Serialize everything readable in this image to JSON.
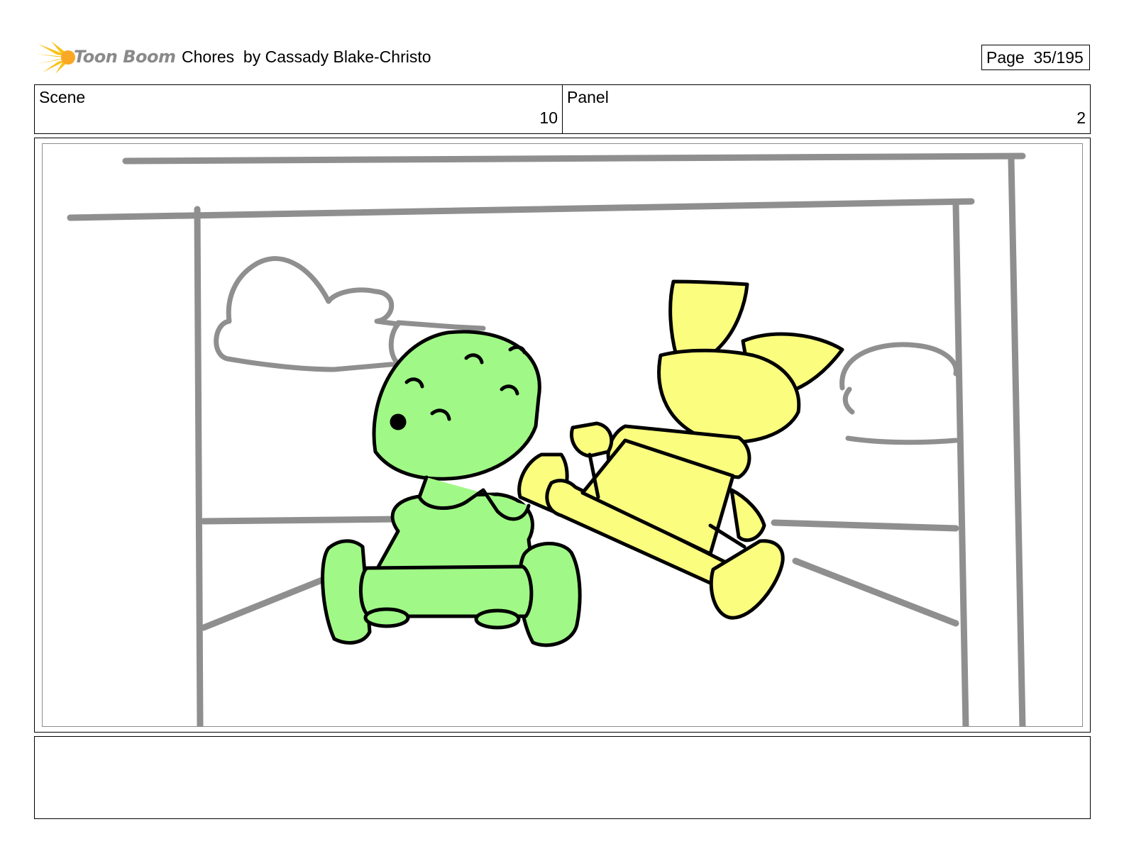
{
  "header": {
    "logo_text": "Toon Boom",
    "title": "Chores  by Cassady Blake-Christo",
    "page_label": "Page  35/195"
  },
  "info": {
    "scene_label": "Scene",
    "scene_value": "10",
    "panel_label": "Panel",
    "panel_value": "2"
  },
  "notes": {
    "text": ""
  },
  "colors": {
    "green_fill": "#a0f986",
    "yellow_fill": "#fafd7e",
    "sketch_gray": "#8f8f8f",
    "logo_sun": "#f7c21a"
  }
}
